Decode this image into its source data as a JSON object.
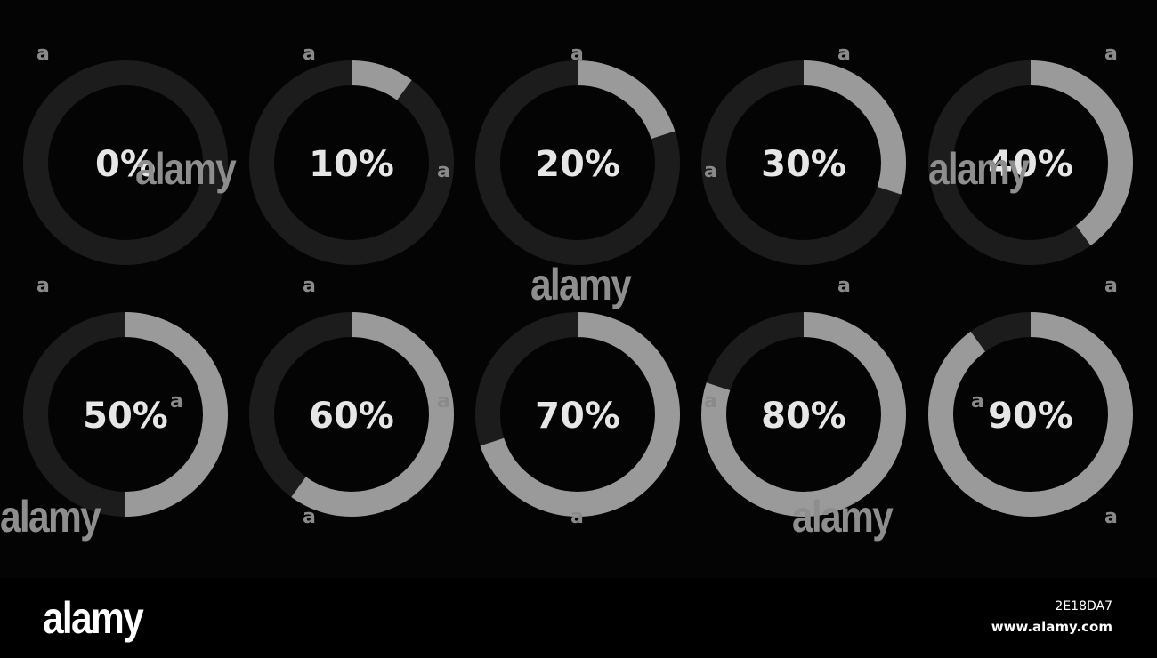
{
  "colors": {
    "background": "#040404",
    "track": "#1c1c1c",
    "progress": "#9a9a9a",
    "label": "#e6e6e6"
  },
  "rings": [
    {
      "label": "0%",
      "fraction": 0.0
    },
    {
      "label": "10%",
      "fraction": 0.1
    },
    {
      "label": "20%",
      "fraction": 0.2
    },
    {
      "label": "30%",
      "fraction": 0.3
    },
    {
      "label": "40%",
      "fraction": 0.4
    },
    {
      "label": "50%",
      "fraction": 0.5
    },
    {
      "label": "60%",
      "fraction": 0.6
    },
    {
      "label": "70%",
      "fraction": 0.7
    },
    {
      "label": "80%",
      "fraction": 0.8
    },
    {
      "label": "90%",
      "fraction": 0.9
    }
  ],
  "watermark": {
    "letter": "a",
    "word": "alamy"
  },
  "footer": {
    "logo": "alamy",
    "image_id": "2E18DA7",
    "url": "www.alamy.com"
  }
}
